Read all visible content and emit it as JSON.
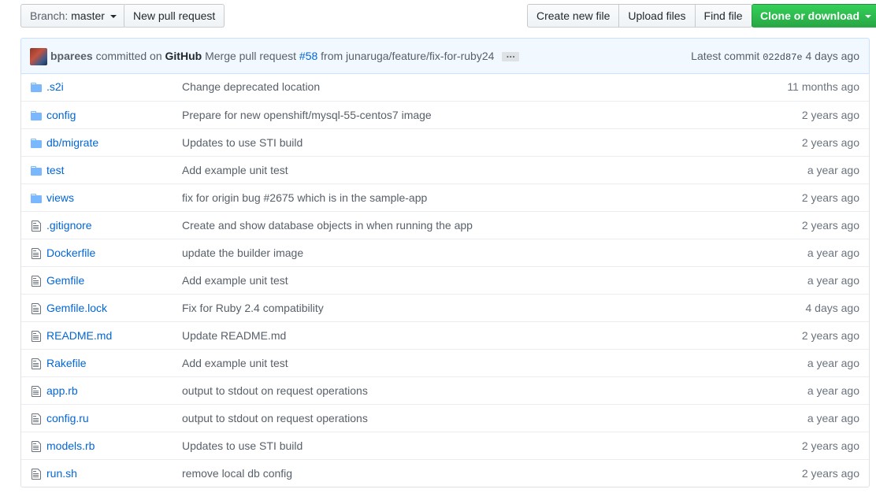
{
  "toolbar": {
    "branch_prefix": "Branch:",
    "branch_name": "master",
    "new_pull_request": "New pull request",
    "create_new_file": "Create new file",
    "upload_files": "Upload files",
    "find_file": "Find file",
    "clone_or_download": "Clone or download"
  },
  "commit": {
    "author": "bparees",
    "committed_on": "committed on",
    "platform": "GitHub",
    "message_prefix": "Merge pull request",
    "pr_number": "#58",
    "message_suffix": "from junaruga/feature/fix-for-ruby24",
    "ellipsis": "…",
    "latest_label": "Latest commit",
    "sha": "022d87e",
    "age": "4 days ago"
  },
  "files": [
    {
      "type": "dir",
      "name": ".s2i",
      "message": "Change deprecated location",
      "age": "11 months ago"
    },
    {
      "type": "dir",
      "name": "config",
      "message": "Prepare for new openshift/mysql-55-centos7 image",
      "age": "2 years ago"
    },
    {
      "type": "dir",
      "name": "db/migrate",
      "message": "Updates to use STI build",
      "age": "2 years ago"
    },
    {
      "type": "dir",
      "name": "test",
      "message": "Add example unit test",
      "age": "a year ago"
    },
    {
      "type": "dir",
      "name": "views",
      "message": "fix for origin bug #2675 which is in the sample-app",
      "age": "2 years ago"
    },
    {
      "type": "file",
      "name": ".gitignore",
      "message": "Create and show database objects in when running the app",
      "age": "2 years ago"
    },
    {
      "type": "file",
      "name": "Dockerfile",
      "message": "update the builder image",
      "age": "a year ago"
    },
    {
      "type": "file",
      "name": "Gemfile",
      "message": "Add example unit test",
      "age": "a year ago"
    },
    {
      "type": "file",
      "name": "Gemfile.lock",
      "message": "Fix for Ruby 2.4 compatibility",
      "age": "4 days ago"
    },
    {
      "type": "file",
      "name": "README.md",
      "message": "Update README.md",
      "age": "2 years ago"
    },
    {
      "type": "file",
      "name": "Rakefile",
      "message": "Add example unit test",
      "age": "a year ago"
    },
    {
      "type": "file",
      "name": "app.rb",
      "message": "output to stdout on request operations",
      "age": "a year ago"
    },
    {
      "type": "file",
      "name": "config.ru",
      "message": "output to stdout on request operations",
      "age": "a year ago"
    },
    {
      "type": "file",
      "name": "models.rb",
      "message": "Updates to use STI build",
      "age": "2 years ago"
    },
    {
      "type": "file",
      "name": "run.sh",
      "message": "remove local db config",
      "age": "2 years ago"
    }
  ],
  "colors": {
    "link": "#0366d6",
    "folder_icon": "#79b8ff",
    "file_icon": "#6a737d",
    "clone_button": "#28a745",
    "commit_bar_bg": "#f1f8ff"
  }
}
